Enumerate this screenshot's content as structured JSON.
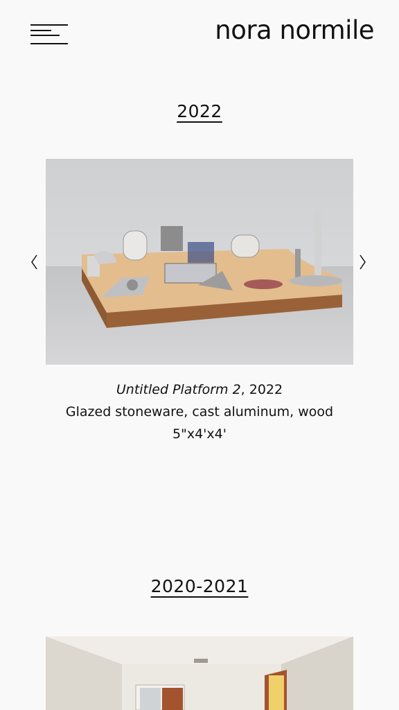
{
  "header": {
    "title": "nora normile",
    "menu_icon": "hamburger-menu-icon"
  },
  "sections": [
    {
      "year": "2022",
      "artwork": {
        "title": "Untitled Platform 2",
        "year_suffix": ", 2022",
        "materials": "Glazed stoneware, cast aluminum, wood",
        "dimensions": "5\"x4'x4'"
      }
    },
    {
      "year": "2020-2021"
    }
  ],
  "icons": {
    "prev": "chevron-left-icon",
    "next": "chevron-right-icon"
  },
  "colors": {
    "background": "#f9f9f9",
    "text": "#111111"
  }
}
